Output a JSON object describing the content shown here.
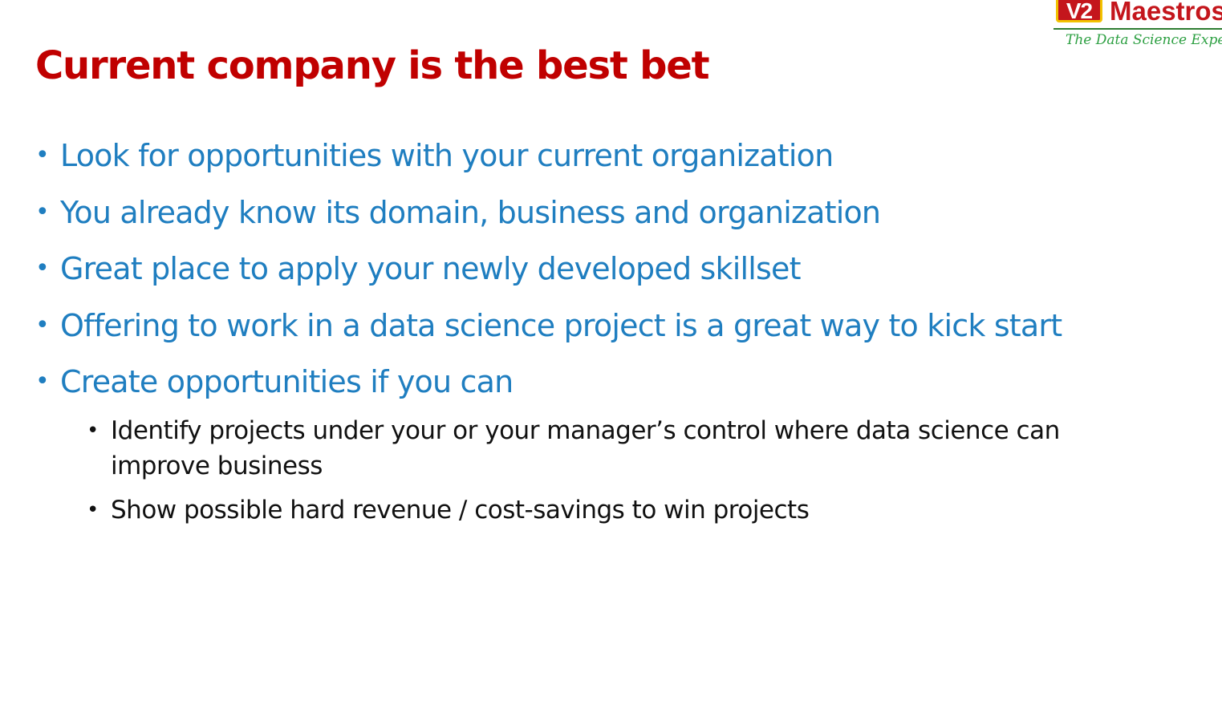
{
  "logo": {
    "mark": "V2",
    "word": "Maestros",
    "tagline": "The Data Science Experts"
  },
  "slide": {
    "title": "Current company is the best bet",
    "bullets": [
      "Look for opportunities with your current organization",
      "You already know its domain, business and organization",
      "Great place to apply your newly developed skillset",
      "Offering to work in a data science project is a great way to kick start",
      "Create opportunities if you can"
    ],
    "sub_bullets": [
      "Identify projects under your or your manager’s control where data science can improve business",
      "Show possible hard revenue / cost-savings to win projects"
    ],
    "bullet_symbol": "•"
  },
  "colors": {
    "title": "#c00000",
    "bullet_text": "#1f7ec0",
    "sub_bullet_text": "#111111",
    "logo_red": "#c4161c",
    "logo_green": "#2ea043"
  }
}
